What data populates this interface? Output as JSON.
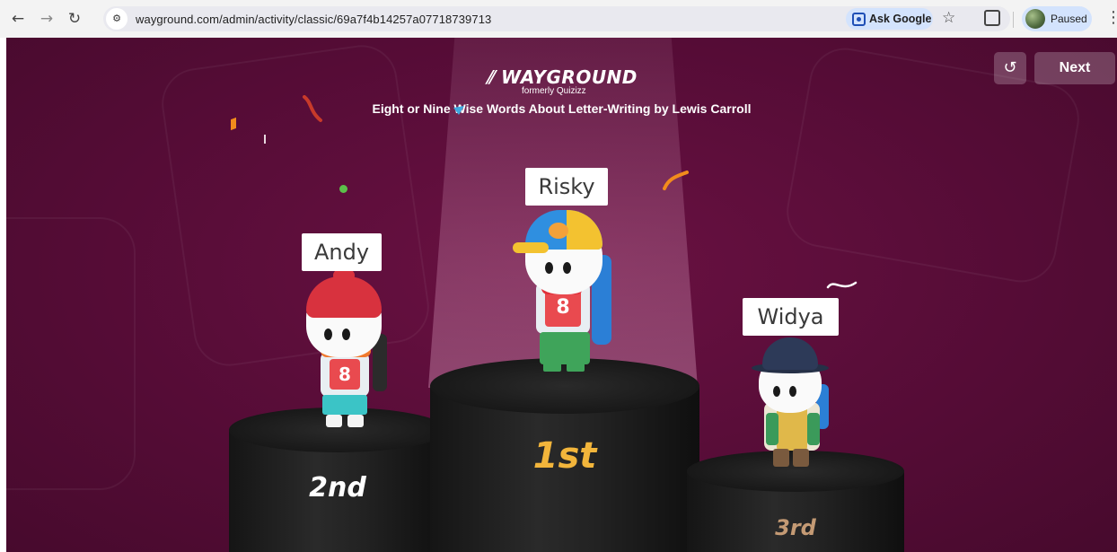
{
  "browser": {
    "url": "wayground.com/admin/activity/classic/69a7f4b14257a07718739713",
    "ask_google": "Ask Google",
    "profile_status": "Paused",
    "icons": {
      "back": "arrow-left-icon",
      "forward": "arrow-right-icon",
      "reload": "reload-icon",
      "site_info": "site-settings-icon",
      "ask_google": "google-lens-icon",
      "bookmark": "star-icon",
      "extensions": "extensions-icon",
      "menu": "kebab-menu-icon"
    }
  },
  "game": {
    "brand": "WAYGROUND",
    "brand_sub": "formerly Quizizz",
    "quiz_title": "Eight or Nine Wise Words About Letter-Writing by Lewis Carroll",
    "reset_icon": "restart-icon",
    "next_label": "Next",
    "colors": {
      "background": "#5a0d39",
      "gold": "#f2b53b",
      "silver": "#ffffff",
      "bronze": "#c49a74"
    },
    "podium": [
      {
        "place": "1st",
        "name": "Risky"
      },
      {
        "place": "2nd",
        "name": "Andy"
      },
      {
        "place": "3rd",
        "name": "Widya"
      }
    ]
  }
}
